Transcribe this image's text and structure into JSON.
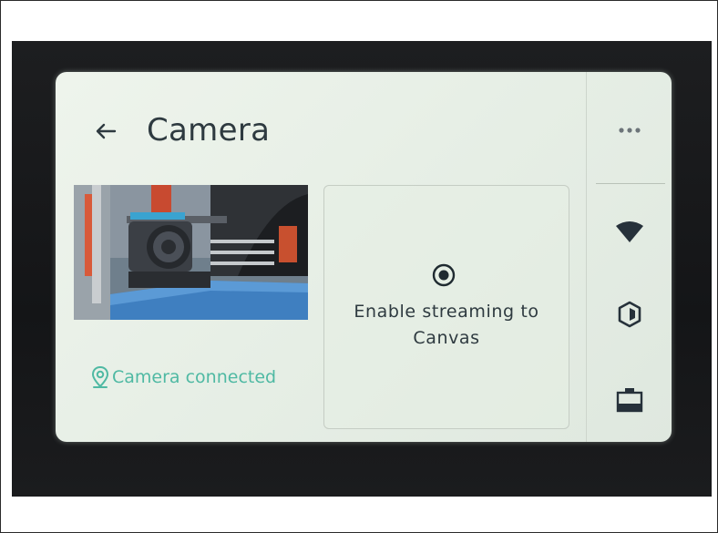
{
  "header": {
    "title": "Camera",
    "back_icon": "back-arrow-icon"
  },
  "camera": {
    "status_text": "Camera connected",
    "status_color": "#4fb9a3",
    "status_icon": "location-pin-icon"
  },
  "stream": {
    "label": "Enable streaming to Canvas",
    "icon": "radio-selected-icon"
  },
  "sidebar": {
    "items": [
      {
        "icon": "more-dots-icon"
      },
      {
        "icon": "wifi-icon"
      },
      {
        "icon": "filament-hexagon-icon"
      },
      {
        "icon": "build-plate-icon"
      }
    ]
  },
  "colors": {
    "text": "#2e3a40",
    "accent": "#4fb9a3",
    "screen": "#e9f0e8"
  }
}
